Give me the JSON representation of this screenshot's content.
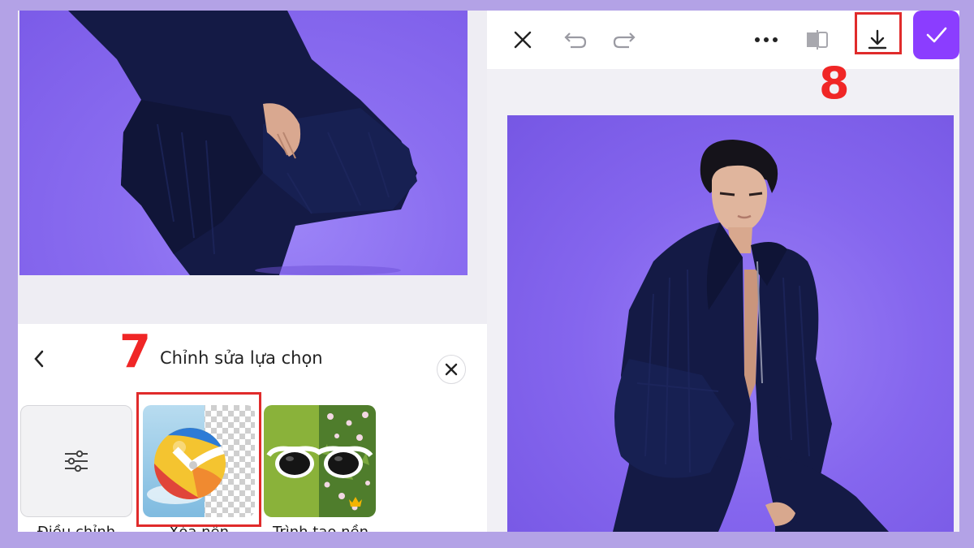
{
  "editor": {
    "panel_title": "Chỉnh sửa lựa chọn",
    "options": [
      {
        "label": "Điều chỉnh",
        "icon": "sliders-icon"
      },
      {
        "label": "Xóa nền",
        "icon": "beach-ball-transparent-icon"
      },
      {
        "label": "Trình tạo nền",
        "icon": "sunglasses-icon",
        "badge": "crown-icon"
      }
    ]
  },
  "toolbar": {
    "close_icon": "close-icon",
    "undo_icon": "undo-icon",
    "redo_icon": "redo-icon",
    "more_icon": "more-icon",
    "compare_icon": "compare-icon",
    "download_icon": "download-icon",
    "confirm_icon": "check-icon"
  },
  "annotations": {
    "step7": "7",
    "step8": "8"
  },
  "colors": {
    "accent_purple": "#8b3dff",
    "highlight_red": "#e02b2b",
    "photo_background": "#8566ee",
    "page_background": "#b3a2e6"
  }
}
